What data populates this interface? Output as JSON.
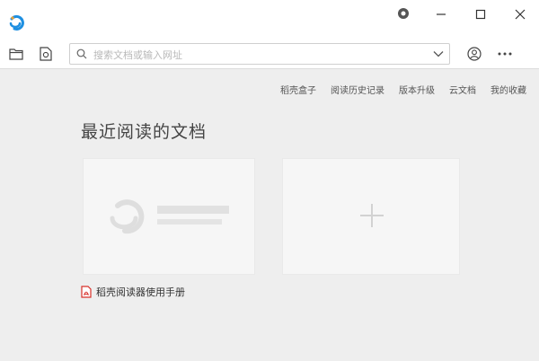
{
  "window": {
    "controls": {
      "settings_icon": "settings-dot-icon",
      "minimize_icon": "minimize-icon",
      "maximize_icon": "maximize-icon",
      "close_icon": "close-icon"
    }
  },
  "toolbar": {
    "search": {
      "placeholder": "搜索文档或输入网址",
      "value": ""
    },
    "icons": [
      "folder-open-icon",
      "document-search-icon",
      "search-icon",
      "chevron-down-icon",
      "user-icon",
      "more-icon"
    ]
  },
  "top_links": [
    "稻壳盒子",
    "阅读历史记录",
    "版本升级",
    "云文档",
    "我的收藏"
  ],
  "main": {
    "heading": "最近阅读的文档",
    "recent_doc": {
      "title": "稻壳阅读器使用手册"
    }
  },
  "colors": {
    "background": "#eeeeee",
    "accent_blue": "#1e8fe1",
    "pdf_red": "#d8312a"
  }
}
